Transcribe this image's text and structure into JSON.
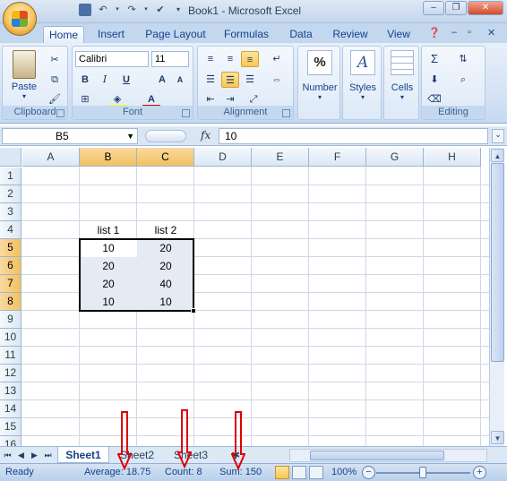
{
  "window": {
    "title": "Book1 - Microsoft Excel",
    "controls": [
      "–",
      "❐",
      "✕"
    ]
  },
  "tabs": [
    {
      "label": "Home",
      "active": true
    },
    {
      "label": "Insert"
    },
    {
      "label": "Page Layout"
    },
    {
      "label": "Formulas"
    },
    {
      "label": "Data"
    },
    {
      "label": "Review"
    },
    {
      "label": "View"
    }
  ],
  "ribbon": {
    "clipboard": {
      "label": "Clipboard",
      "paste": "Paste"
    },
    "font": {
      "label": "Font",
      "name": "Calibri",
      "size": "11",
      "bold": "B",
      "italic": "I",
      "underline": "U"
    },
    "alignment": {
      "label": "Alignment"
    },
    "number": {
      "label": "Number",
      "symbol": "%"
    },
    "styles": {
      "label": "Styles"
    },
    "cells": {
      "label": "Cells"
    },
    "editing": {
      "label": "Editing"
    }
  },
  "formula_bar": {
    "name_box": "B5",
    "fx": "fx",
    "value": "10"
  },
  "grid": {
    "columns": [
      "A",
      "B",
      "C",
      "D",
      "E",
      "F",
      "G",
      "H"
    ],
    "selected_columns": [
      "B",
      "C"
    ],
    "rows": [
      "1",
      "2",
      "3",
      "4",
      "5",
      "6",
      "7",
      "8",
      "9",
      "10",
      "11",
      "12",
      "13",
      "14",
      "15",
      "16"
    ],
    "selected_rows": [
      "5",
      "6",
      "7",
      "8"
    ],
    "headers": {
      "b4": "list 1",
      "c4": "list 2"
    },
    "data": [
      {
        "b": "10",
        "c": "20"
      },
      {
        "b": "20",
        "c": "20"
      },
      {
        "b": "20",
        "c": "40"
      },
      {
        "b": "10",
        "c": "10"
      }
    ]
  },
  "sheets": [
    {
      "label": "Sheet1",
      "active": true
    },
    {
      "label": "Sheet2"
    },
    {
      "label": "Sheet3"
    }
  ],
  "status": {
    "ready": "Ready",
    "average": "Average: 18.75",
    "count": "Count: 8",
    "sum": "Sum: 150",
    "zoom": "100%"
  },
  "colors": {
    "accent": "#15428b",
    "selection_header": "#f1c15f",
    "arrow": "#e00000"
  }
}
